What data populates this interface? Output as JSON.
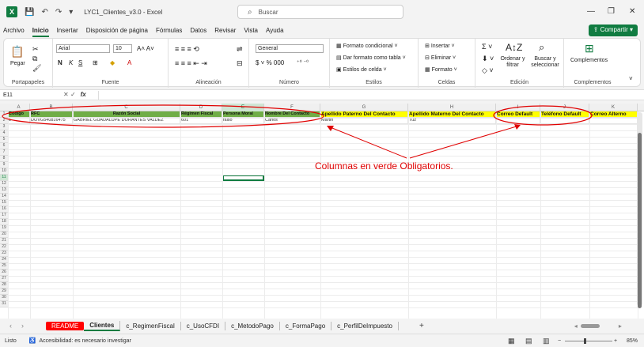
{
  "window": {
    "title": "LYC1_Clientes_v3.0 - Excel",
    "search_placeholder": "Buscar"
  },
  "menu": {
    "items": [
      "Archivo",
      "Inicio",
      "Insertar",
      "Disposición de página",
      "Fórmulas",
      "Datos",
      "Revisar",
      "Vista",
      "Ayuda"
    ],
    "share_label": "Compartir"
  },
  "ribbon": {
    "clipboard": {
      "paste": "Pegar",
      "label": "Portapapeles"
    },
    "font": {
      "name": "Arial",
      "size": "10",
      "label": "Fuente"
    },
    "alignment": {
      "label": "Alineación"
    },
    "number": {
      "format": "General",
      "label": "Número"
    },
    "styles": {
      "conditional": "Formato condicional",
      "table": "Dar formato como tabla",
      "cell_styles": "Estilos de celda",
      "label": "Estilos"
    },
    "cells": {
      "insert": "Insertar",
      "delete": "Eliminar",
      "format": "Formato",
      "label": "Celdas"
    },
    "editing": {
      "sort": "Ordenar y filtrar",
      "find": "Buscar y seleccionar",
      "label": "Edición"
    },
    "addins": {
      "button": "Complementos",
      "label": "Complementos"
    }
  },
  "formula_bar": {
    "name_box": "E11",
    "fx": "fx",
    "value": ""
  },
  "sheet": {
    "columns": [
      "A",
      "B",
      "C",
      "D",
      "E",
      "F",
      "G",
      "H",
      "I",
      "J",
      "K"
    ],
    "headers": [
      "Código",
      "RFC",
      "Razón Social",
      "Régimen Fiscal",
      "Persona Moral",
      "Nombre Del Contacto",
      "Apellido Paterno Del Contacto",
      "Apellido Materno Del Contacto",
      "Correo Default",
      "Teléfono Default",
      "Correo Alterno"
    ],
    "row2": [
      "1",
      "DOVG540816475",
      "GABRIEL GUADALUPE DORANTES VALDEZ",
      "601",
      "falso",
      "Carlos",
      "Martin",
      "Tuz",
      "",
      "",
      ""
    ],
    "row_count": 31,
    "selected_cell": "E11"
  },
  "annotation": {
    "text": "Columnas en verde Obligatorios."
  },
  "sheet_tabs": [
    "README",
    "Clientes",
    "c_RegimenFiscal",
    "c_UsoCFDI",
    "c_MetodoPago",
    "c_FormaPago",
    "c_PerfilDeImpuesto"
  ],
  "active_tab": "Clientes",
  "status": {
    "ready": "Listo",
    "accessibility": "Accesibilidad: es necesario investigar",
    "zoom": "85%"
  },
  "colors": {
    "required": "#70ad47",
    "optional": "#ffff00",
    "annotation": "#e00000",
    "accent": "#107c41"
  }
}
